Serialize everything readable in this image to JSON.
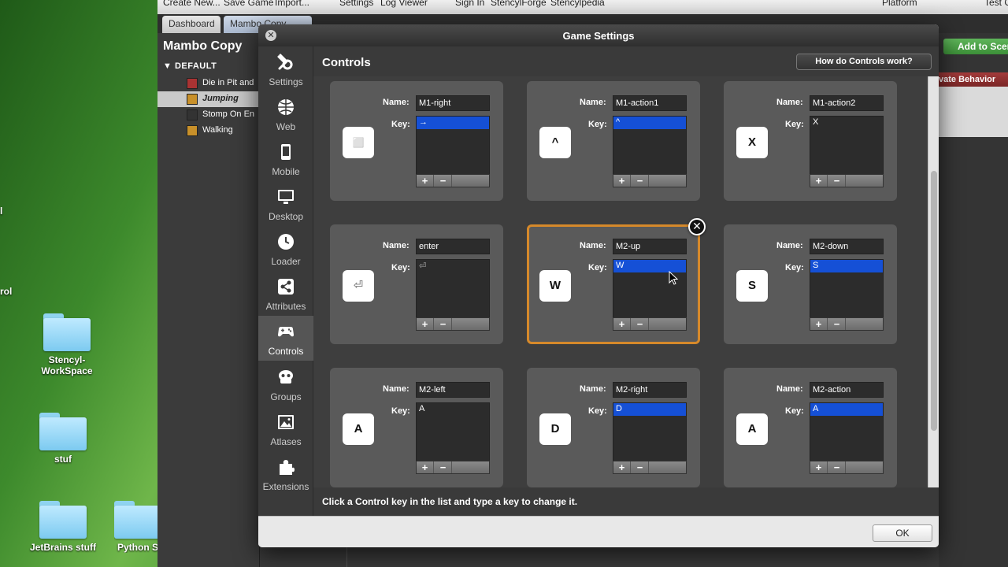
{
  "desktop": {
    "items": [
      {
        "label": "Stencyl-\nWorkSpace"
      },
      {
        "label": "stuf"
      },
      {
        "label": "JetBrains stuff"
      },
      {
        "label": "Python S"
      }
    ],
    "edge_fragment": "rol"
  },
  "app": {
    "menu": [
      "Create New...",
      "Save Game",
      "Import...",
      "Settings",
      "Log Viewer",
      "Sign In",
      "StencylForge",
      "Stencylpedia",
      "Platform",
      "Test G"
    ],
    "tabs": [
      {
        "label": "Dashboard"
      },
      {
        "label": "Mambo Copy"
      }
    ],
    "left_panel": {
      "title": "Mambo Copy",
      "group": "DEFAULT",
      "items": [
        {
          "label": "Die in Pit and"
        },
        {
          "label": "Jumping"
        },
        {
          "label": "Stomp On En"
        },
        {
          "label": "Walking"
        }
      ]
    },
    "add_to_scene": "Add to Scen",
    "private_behavior": "vate Behavior"
  },
  "dialog": {
    "title": "Game Settings",
    "nav": [
      {
        "label": "Settings",
        "icon": "wrench-icon"
      },
      {
        "label": "Web",
        "icon": "globe-icon"
      },
      {
        "label": "Mobile",
        "icon": "phone-icon"
      },
      {
        "label": "Desktop",
        "icon": "monitor-icon"
      },
      {
        "label": "Loader",
        "icon": "clock-icon"
      },
      {
        "label": "Attributes",
        "icon": "share-icon"
      },
      {
        "label": "Controls",
        "icon": "gamepad-icon"
      },
      {
        "label": "Groups",
        "icon": "groups-icon"
      },
      {
        "label": "Atlases",
        "icon": "image-icon"
      },
      {
        "label": "Extensions",
        "icon": "puzzle-icon"
      }
    ],
    "section_title": "Controls",
    "help_button": "How do Controls work?",
    "labels": {
      "name": "Name:",
      "key": "Key:"
    },
    "controls": [
      {
        "key_glyph": "⬜",
        "name": "M1-right",
        "keys": [
          "→"
        ],
        "highlighted": true
      },
      {
        "key_glyph": "^",
        "name": "M1-action1",
        "keys": [
          "^"
        ],
        "highlighted": true
      },
      {
        "key_glyph": "X",
        "name": "M1-action2",
        "keys": [
          "X"
        ],
        "highlighted": false
      },
      {
        "key_glyph": "⏎",
        "name": "enter",
        "keys": [
          "⏎"
        ],
        "highlighted": false
      },
      {
        "key_glyph": "W",
        "name": "M2-up",
        "keys": [
          "W"
        ],
        "highlighted": true
      },
      {
        "key_glyph": "S",
        "name": "M2-down",
        "keys": [
          "S"
        ],
        "highlighted": true
      },
      {
        "key_glyph": "A",
        "name": "M2-left",
        "keys": [
          "A"
        ],
        "highlighted": false
      },
      {
        "key_glyph": "D",
        "name": "M2-right",
        "keys": [
          "D"
        ],
        "highlighted": true
      },
      {
        "key_glyph": "A",
        "name": "M2-action",
        "keys": [
          "A"
        ],
        "highlighted": true
      }
    ],
    "list_buttons": {
      "add": "+",
      "remove": "−"
    },
    "delete_glyph": "✕",
    "hint": "Click a Control key in the list and type a key to change it.",
    "ok": "OK"
  },
  "colors": {
    "selection": "#1550d6",
    "selected_border": "#d6892a",
    "add_scene": "#4ca048",
    "private_behavior": "#8e3030"
  }
}
